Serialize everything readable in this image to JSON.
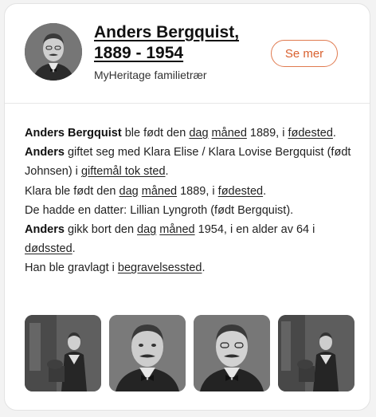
{
  "person": {
    "name_line1": "Anders Bergquist,",
    "name_line2": "1889 - 1954",
    "source": "MyHeritage familietrær",
    "see_more_label": "Se mer"
  },
  "bio": {
    "s1_name": "Anders Bergquist",
    "s1_text1": " ble født den ",
    "s1_day": "dag",
    "s1_month": "måned",
    "s1_text2": " 1889, i ",
    "s1_place": "fødested",
    "s1_end": ".",
    "s2_name": "Anders",
    "s2_text1": " giftet seg med Klara Elise / Klara Lovise Bergquist (født Johnsen) i ",
    "s2_place": "giftemål tok sted",
    "s2_end": ".",
    "s3_text1": "Klara ble født den ",
    "s3_day": "dag",
    "s3_month": "måned",
    "s3_text2": " 1889, i ",
    "s3_place": "fødested",
    "s3_end": ".",
    "s4_text": "De hadde en datter: Lillian Lyngroth (født Bergquist).",
    "s5_name": "Anders",
    "s5_text1": " gikk bort den ",
    "s5_day": "dag",
    "s5_month": "måned",
    "s5_text2": " 1954, i en alder av 64 i ",
    "s5_place": "dødssted",
    "s5_end": ".",
    "s6_text1": "Han ble gravlagt i ",
    "s6_place": "begravelsessted",
    "s6_end": "."
  },
  "photos": [
    {
      "kind": "full-length-standing"
    },
    {
      "kind": "portrait-closeup"
    },
    {
      "kind": "portrait-closeup"
    },
    {
      "kind": "full-length-standing"
    }
  ],
  "colors": {
    "accent": "#d9602e",
    "accent_border": "#e07a4f",
    "text": "#222222"
  }
}
